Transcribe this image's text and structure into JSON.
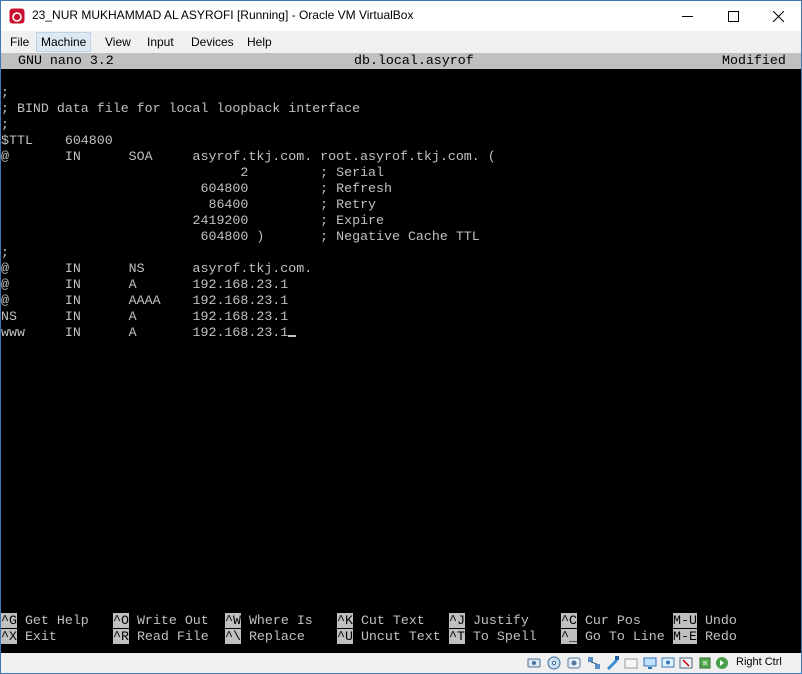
{
  "window": {
    "title": "23_NUR MUKHAMMAD AL ASYROFI [Running] - Oracle VM VirtualBox",
    "accent": "#3c78b4"
  },
  "menubar": {
    "items": [
      "File",
      "Machine",
      "View",
      "Input",
      "Devices",
      "Help"
    ],
    "active": "Machine"
  },
  "nano": {
    "version": "GNU nano 3.2",
    "filename": "db.local.asyrof",
    "state": "Modified"
  },
  "file_lines": [
    ";",
    "; BIND data file for local loopback interface",
    ";",
    "$TTL    604800",
    "@       IN      SOA     asyrof.tkj.com. root.asyrof.tkj.com. (",
    "                              2         ; Serial",
    "                         604800         ; Refresh",
    "                          86400         ; Retry",
    "                        2419200         ; Expire",
    "                         604800 )       ; Negative Cache TTL",
    ";",
    "@       IN      NS      asyrof.tkj.com.",
    "@       IN      A       192.168.23.1",
    "@       IN      AAAA    192.168.23.1",
    "NS      IN      A       192.168.23.1",
    "www     IN      A       192.168.23.1"
  ],
  "shortcuts": [
    [
      {
        "key": "^G",
        "label": "Get Help"
      },
      {
        "key": "^X",
        "label": "Exit"
      }
    ],
    [
      {
        "key": "^O",
        "label": "Write Out"
      },
      {
        "key": "^R",
        "label": "Read File"
      }
    ],
    [
      {
        "key": "^W",
        "label": "Where Is"
      },
      {
        "key": "^\\",
        "label": "Replace"
      }
    ],
    [
      {
        "key": "^K",
        "label": "Cut Text"
      },
      {
        "key": "^U",
        "label": "Uncut Text"
      }
    ],
    [
      {
        "key": "^J",
        "label": "Justify"
      },
      {
        "key": "^T",
        "label": "To Spell"
      }
    ],
    [
      {
        "key": "^C",
        "label": "Cur Pos"
      },
      {
        "key": "^_",
        "label": "Go To Line"
      }
    ],
    [
      {
        "key": "M-U",
        "label": "Undo"
      },
      {
        "key": "M-E",
        "label": "Redo"
      }
    ]
  ],
  "statusbar": {
    "host_key": "Right Ctrl",
    "icons": [
      "hard-disk-icon",
      "optical-drive-icon",
      "audio-icon",
      "network-icon",
      "usb-icon",
      "shared-folder-icon",
      "display-icon",
      "video-capture-icon",
      "recording-icon",
      "cpu-icon",
      "mouse-integration-icon",
      "keyboard-icon"
    ]
  }
}
